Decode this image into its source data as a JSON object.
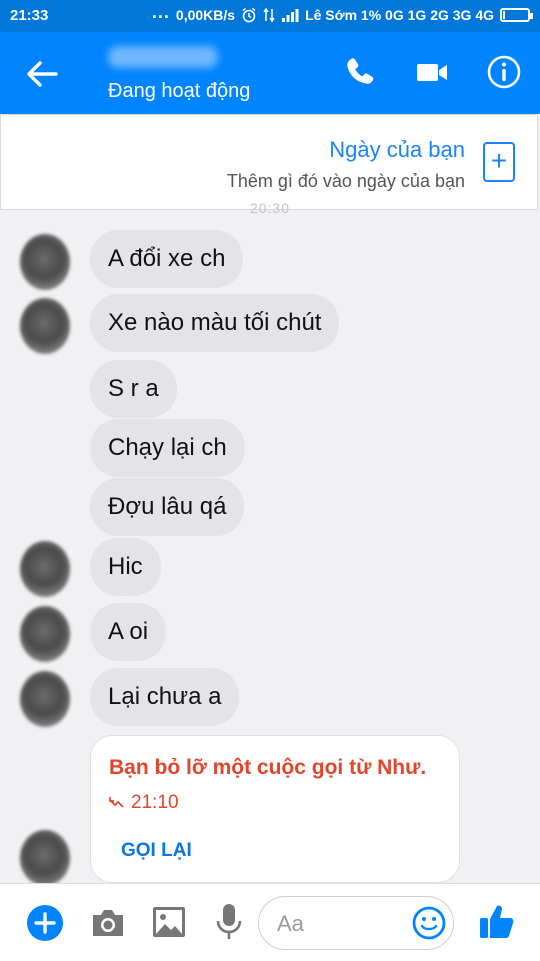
{
  "status_bar": {
    "time": "21:33",
    "network_speed": "0,00KB/s",
    "carrier": "Lê Sớm 1% 0G 1G 2G 3G 4G",
    "more_icon": "ellipsis-icon",
    "alarm_icon": "alarm-clock-icon",
    "signal_icon": "signal-icon",
    "battery_icon": "battery-icon"
  },
  "header": {
    "presence": "Đang hoạt động",
    "back_icon": "arrow-left-icon",
    "call_icon": "phone-icon",
    "video_icon": "video-camera-icon",
    "info_icon": "info-icon"
  },
  "day_banner": {
    "title": "Ngày của bạn",
    "subtitle": "Thêm gì đó vào ngày của bạn",
    "add_icon": "plus-square-icon"
  },
  "thread": {
    "timestamp": "20:30",
    "messages": [
      {
        "text": "A đổi xe ch"
      },
      {
        "text": "Xe nào màu tối chút"
      },
      {
        "text": "S r a"
      },
      {
        "text": "Chạy lại ch"
      },
      {
        "text": "Đợu lâu qá"
      },
      {
        "text": "Hic"
      },
      {
        "text": "A oi"
      },
      {
        "text": "Lại chưa a"
      }
    ],
    "missed_call": {
      "text": "Bạn bỏ lỡ một cuộc gọi từ Như.",
      "time": "21:10",
      "callback_label": "GỌI LẠI",
      "missed_icon": "missed-call-icon"
    }
  },
  "composer": {
    "placeholder": "Aa",
    "icons": [
      "plus-circle-icon",
      "camera-icon",
      "image-icon",
      "microphone-icon",
      "emoji-icon",
      "thumbs-up-icon"
    ]
  },
  "colors": {
    "brand": "#0084ff",
    "status_bar": "#0077d9",
    "bubble": "#e4e4e8",
    "missed_call": "#e2452b"
  }
}
